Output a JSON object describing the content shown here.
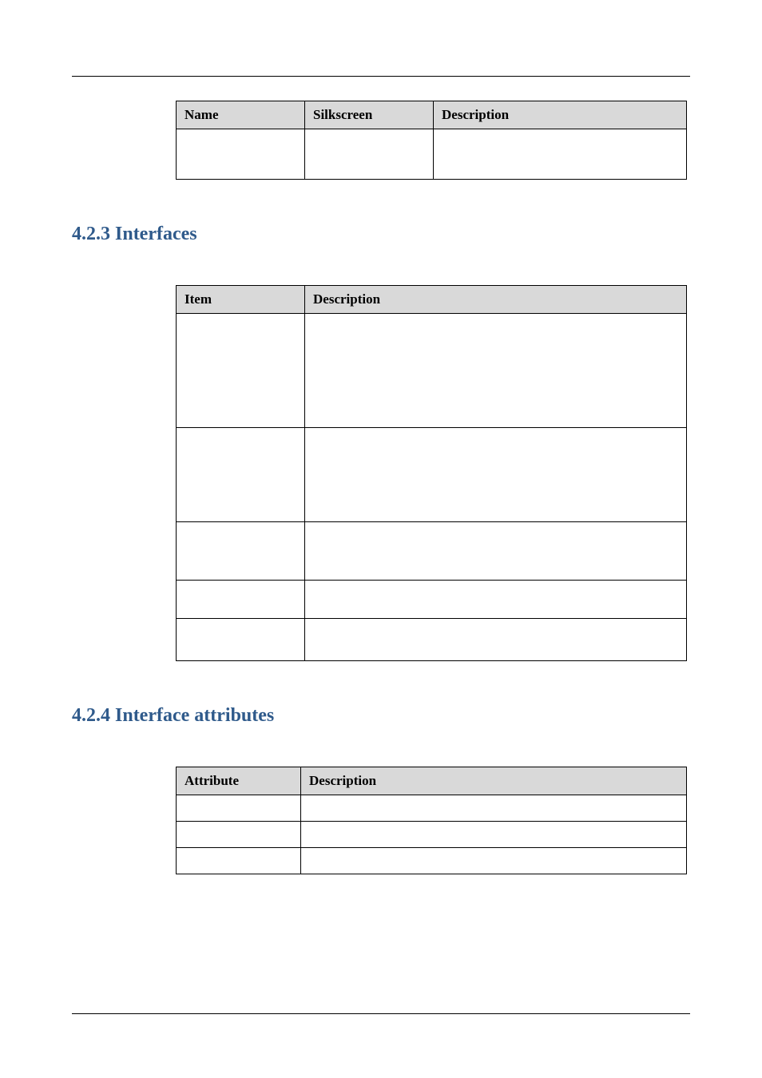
{
  "table1": {
    "headers": [
      "Name",
      "Silkscreen",
      "Description"
    ],
    "rows": [
      {
        "c0": "",
        "c1": "",
        "c2": ""
      }
    ]
  },
  "section1": {
    "number": "4.2.3",
    "title": "Interfaces"
  },
  "table2": {
    "headers": [
      "Item",
      "Description"
    ],
    "rows": [
      {
        "c0": "",
        "c1": ""
      },
      {
        "c0": "",
        "c1": ""
      },
      {
        "c0": "",
        "c1": ""
      },
      {
        "c0": "",
        "c1": ""
      },
      {
        "c0": "",
        "c1": ""
      }
    ]
  },
  "section2": {
    "number": "4.2.4",
    "title": "Interface attributes"
  },
  "table3": {
    "headers": [
      "Attribute",
      "Description"
    ],
    "rows": [
      {
        "c0": "",
        "c1": ""
      },
      {
        "c0": "",
        "c1": ""
      },
      {
        "c0": "",
        "c1": ""
      }
    ]
  }
}
